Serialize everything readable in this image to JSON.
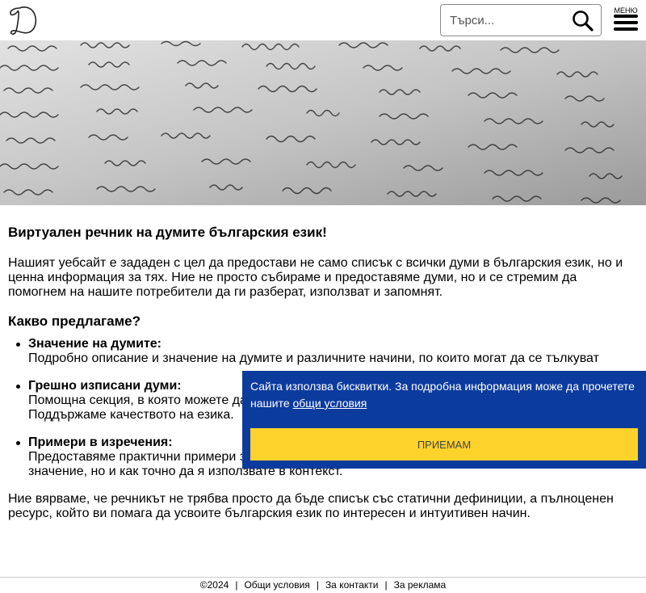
{
  "header": {
    "logo_icon": "letter-d-logo-icon",
    "search": {
      "placeholder": "Търси...",
      "value": "",
      "icon": "magnifier-icon"
    },
    "menu": {
      "label": "МЕНЮ",
      "icon": "hamburger-icon"
    }
  },
  "hero": {
    "icon": "handwritten-paper-image"
  },
  "main": {
    "title": "Виртуален речник на думите българския език!",
    "intro": "Нашият уебсайт е зададен с цел да предостави не само списък с всички думи в българския език, но и ценна информация за тях. Ние не просто събираме и предоставяме думи, но и се стремим да помогнем на нашите потребители да ги разберат, използват и запомнят.",
    "section_title": "Какво предлагаме?",
    "features": [
      {
        "title": "Значение на думите:",
        "desc": "Подробно описание и значение на думите и различните начини, по които могат да се тълкуват"
      },
      {
        "title": "Грешно изписани думи:",
        "desc": "Помощна секция, в която можете да намерите често срещани думи, които хората изписват грешно. Поддържаме качеството на езика."
      },
      {
        "title": "Примери в изречения:",
        "desc": "Предоставяме практични примери за употребата на всяка дума, така че да не само разберете значение, но и как точно да я използвате в контекст."
      }
    ],
    "closing": "Ние вярваме, че речникът не трябва просто да бъде списък със статични дефиниции, а пълноценен ресурс, който ви помага да усвоите българския език по интересен и интуитивен начин."
  },
  "cookie": {
    "text": "Сайта използва бисквитки. За подробна информация може да прочетете нашите ",
    "link": "общи условия",
    "accept": "ПРИЕМАМ",
    "bg_color": "#0c3b9e",
    "button_color": "#fdd22b"
  },
  "footer": {
    "copyright": "©2024",
    "links": [
      "Общи условия",
      "За контакти",
      "За реклама"
    ]
  }
}
